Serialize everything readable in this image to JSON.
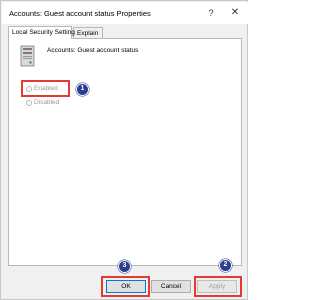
{
  "window": {
    "title": "Accounts: Guest account status Properties",
    "help_glyph": "?",
    "close_glyph": "✕"
  },
  "tabs": [
    {
      "label": "Local Security Setting",
      "selected": true
    },
    {
      "label": "Explain",
      "selected": false
    }
  ],
  "policy": {
    "icon": "server-policy-icon",
    "name": "Accounts: Guest account status"
  },
  "options": {
    "enabled_label": "Enabled",
    "disabled_label": "Disabled",
    "selected": "none"
  },
  "annotations": {
    "step1": "1",
    "step2": "2",
    "step3": "3",
    "highlight_color": "#e53935",
    "badge_color": "#2b3e8f"
  },
  "buttons": {
    "ok": "OK",
    "cancel": "Cancel",
    "apply": "Apply",
    "apply_disabled": true
  }
}
